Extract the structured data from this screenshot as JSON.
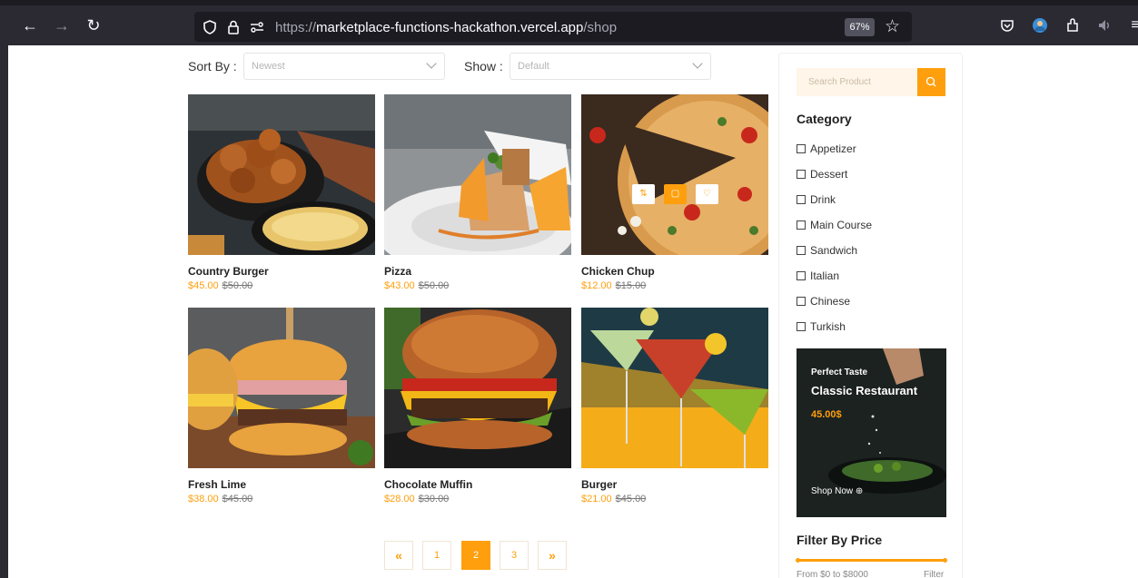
{
  "browser": {
    "url_scheme": "https://",
    "url_host": "marketplace-functions-hackathon.vercel.app",
    "url_path": "/shop",
    "zoom": "67%"
  },
  "controls": {
    "sort_label": "Sort By :",
    "sort_value": "Newest",
    "show_label": "Show :",
    "show_value": "Default"
  },
  "products": [
    {
      "name": "Country Burger",
      "price": "$45.00",
      "old_price": "$50.00"
    },
    {
      "name": "Pizza",
      "price": "$43.00",
      "old_price": "$50.00"
    },
    {
      "name": "Chicken Chup",
      "price": "$12.00",
      "old_price": "$15.00"
    },
    {
      "name": "Fresh Lime",
      "price": "$38.00",
      "old_price": "$45.00"
    },
    {
      "name": "Chocolate Muffin",
      "price": "$28.00",
      "old_price": "$30.00"
    },
    {
      "name": "Burger",
      "price": "$21.00",
      "old_price": "$45.00"
    }
  ],
  "pagination": {
    "prev": "«",
    "pages": [
      "1",
      "2",
      "3"
    ],
    "active": "2",
    "next": "»"
  },
  "sidebar": {
    "search_placeholder": "Search Product",
    "category_title": "Category",
    "categories": [
      "Appetizer",
      "Dessert",
      "Drink",
      "Main Course",
      "Sandwich",
      "Italian",
      "Chinese",
      "Turkish"
    ],
    "promo": {
      "kicker": "Perfect Taste",
      "title": "Classic Restaurant",
      "price": "45.00$",
      "cta": "Shop Now"
    },
    "price_title": "Filter By Price",
    "price_range": "From $0 to $8000",
    "filter_label": "Filter"
  },
  "colors": {
    "accent": "#ff9f0d",
    "toolbar": "#2b2a33",
    "urlbar": "#1c1b22"
  }
}
